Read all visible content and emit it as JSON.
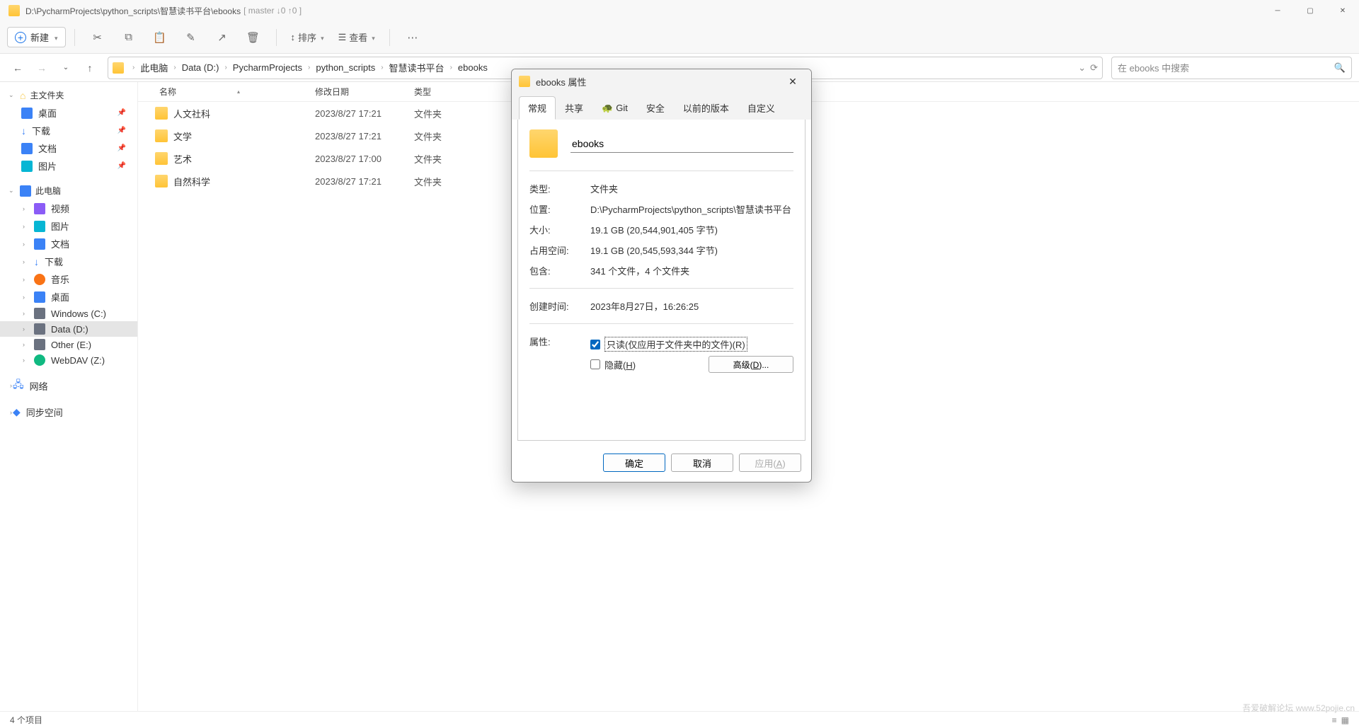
{
  "title": {
    "path": "D:\\PycharmProjects\\python_scripts\\智慧读书平台\\ebooks",
    "branch": "[ master ↓0 ↑0 ]"
  },
  "toolbar": {
    "new": "新建",
    "sort": "排序",
    "view": "查看"
  },
  "breadcrumb": {
    "items": [
      "此电脑",
      "Data (D:)",
      "PycharmProjects",
      "python_scripts",
      "智慧读书平台",
      "ebooks"
    ]
  },
  "search": {
    "placeholder": "在 ebooks 中搜索"
  },
  "sidebar": {
    "home": "主文件夹",
    "desktop": "桌面",
    "downloads": "下载",
    "documents": "文档",
    "pictures": "图片",
    "thispc": "此电脑",
    "video": "视频",
    "pic2": "图片",
    "doc2": "文档",
    "dl2": "下载",
    "music": "音乐",
    "desk2": "桌面",
    "c": "Windows (C:)",
    "d": "Data (D:)",
    "e": "Other (E:)",
    "z": "WebDAV (Z:)",
    "network": "网络",
    "sync": "同步空间"
  },
  "columns": {
    "name": "名称",
    "modified": "修改日期",
    "type": "类型"
  },
  "files": [
    {
      "name": "人文社科",
      "date": "2023/8/27 17:21",
      "type": "文件夹"
    },
    {
      "name": "文学",
      "date": "2023/8/27 17:21",
      "type": "文件夹"
    },
    {
      "name": "艺术",
      "date": "2023/8/27 17:00",
      "type": "文件夹"
    },
    {
      "name": "自然科学",
      "date": "2023/8/27 17:21",
      "type": "文件夹"
    }
  ],
  "status": {
    "count": "4 个项目"
  },
  "dialog": {
    "title": "ebooks 属性",
    "tabs": {
      "general": "常规",
      "share": "共享",
      "git": "Git",
      "security": "安全",
      "prev": "以前的版本",
      "custom": "自定义"
    },
    "name": "ebooks",
    "labels": {
      "type": "类型:",
      "location": "位置:",
      "size": "大小:",
      "ondisk": "占用空间:",
      "contains": "包含:",
      "created": "创建时间:",
      "attrs": "属性:"
    },
    "values": {
      "type": "文件夹",
      "location": "D:\\PycharmProjects\\python_scripts\\智慧读书平台",
      "size": "19.1 GB (20,544,901,405 字节)",
      "ondisk": "19.1 GB (20,545,593,344 字节)",
      "contains": "341 个文件，4 个文件夹",
      "created": "2023年8月27日，16:26:25"
    },
    "readonly": "只读(仅应用于文件夹中的文件)(R)",
    "hidden": "隐藏(H)",
    "advanced": "高级(D)...",
    "buttons": {
      "ok": "确定",
      "cancel": "取消",
      "apply": "应用(A)"
    }
  },
  "watermark": "吾爱破解论坛\nwww.52pojie.cn"
}
